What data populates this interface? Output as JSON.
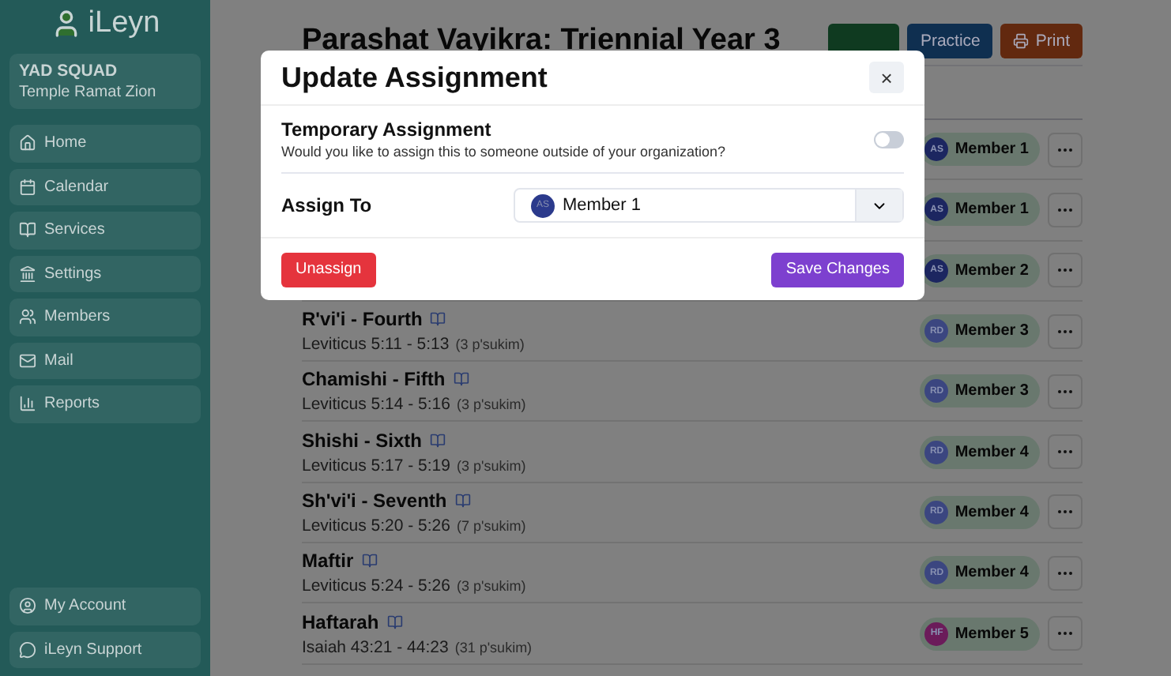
{
  "sidebar": {
    "brand": "iLeyn",
    "org": {
      "name": "YAD SQUAD",
      "subtitle": "Temple Ramat Zion"
    },
    "items": [
      {
        "label": "Home"
      },
      {
        "label": "Calendar"
      },
      {
        "label": "Services"
      },
      {
        "label": "Settings"
      },
      {
        "label": "Members"
      },
      {
        "label": "Mail"
      },
      {
        "label": "Reports"
      }
    ],
    "bottom_items": [
      {
        "label": "My Account"
      },
      {
        "label": "iLeyn Support"
      }
    ]
  },
  "page": {
    "title": "Parashat Vayikra: Triennial Year 3",
    "buttons": [
      {
        "kind": "green"
      },
      {
        "kind": "blue",
        "label": "Practice"
      },
      {
        "kind": "orange",
        "label": "Print"
      }
    ]
  },
  "rows": [
    {
      "member": "Member 1",
      "initials": "AS",
      "color": "#1c2660"
    },
    {
      "member": "Member 1",
      "initials": "AS",
      "color": "#1c2660"
    },
    {
      "member": "Member 2",
      "initials": "AS",
      "color": "#1c2660"
    },
    {
      "name": "R'vi'i - Fourth",
      "range": "Leviticus 5:11 - 5:13",
      "count": "(3 p'sukim)",
      "member": "Member 3",
      "initials": "RD",
      "color": "#3b4680"
    },
    {
      "name": "Chamishi - Fifth",
      "range": "Leviticus 5:14 - 5:16",
      "count": "(3 p'sukim)",
      "member": "Member 3",
      "initials": "RD",
      "color": "#3b4680"
    },
    {
      "name": "Shishi - Sixth",
      "range": "Leviticus 5:17 - 5:19",
      "count": "(3 p'sukim)",
      "member": "Member 4",
      "initials": "RD",
      "color": "#3b4680"
    },
    {
      "name": "Sh'vi'i - Seventh",
      "range": "Leviticus 5:20 - 5:26",
      "count": "(7 p'sukim)",
      "member": "Member 4",
      "initials": "RD",
      "color": "#3b4680"
    },
    {
      "name": "Maftir",
      "range": "Leviticus 5:24 - 5:26",
      "count": "(3 p'sukim)",
      "member": "Member 4",
      "initials": "RD",
      "color": "#3b4680"
    },
    {
      "name": "Haftarah",
      "range": "Isaiah 43:21 - 44:23",
      "count": "(31 p'sukim)",
      "member": "Member 5",
      "initials": "HF",
      "color": "#6b1c5a"
    }
  ],
  "modal": {
    "title": "Update Assignment",
    "close": "×",
    "temporary": {
      "label": "Temporary Assignment",
      "description": "Would you like to assign this to someone outside of your organization?",
      "on": false
    },
    "assign_to": {
      "label": "Assign To",
      "value": "Member 1",
      "initials": "AS",
      "color": "#2b3a8c"
    },
    "buttons": [
      {
        "kind": "danger",
        "label": "Unassign"
      },
      {
        "kind": "primary",
        "label": "Save Changes"
      }
    ]
  }
}
